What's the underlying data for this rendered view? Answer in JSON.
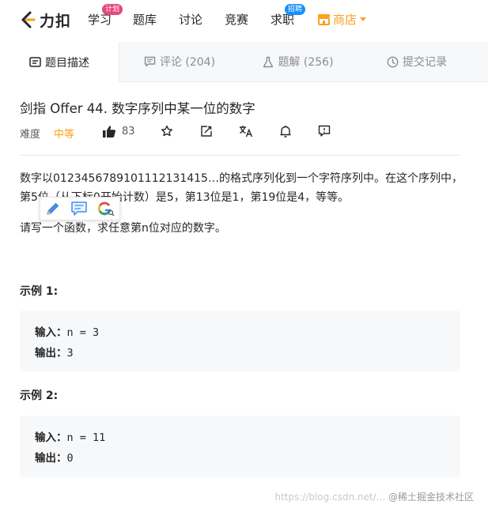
{
  "nav": {
    "logo_text": "力扣",
    "items": [
      {
        "label": "学习",
        "badge": "计划"
      },
      {
        "label": "题库"
      },
      {
        "label": "讨论"
      },
      {
        "label": "竞赛"
      },
      {
        "label": "求职",
        "badge": "招聘"
      }
    ],
    "shop_label": "商店",
    "colors": {
      "accent": "#ffa116",
      "shop": "#ff9f1c",
      "badge_pink": "#e5487a",
      "badge_blue": "#1890ff"
    }
  },
  "tabs": [
    {
      "label": "题目描述",
      "icon": "description-icon",
      "active": true
    },
    {
      "label": "评论 (204)",
      "icon": "comment-icon"
    },
    {
      "label": "题解 (256)",
      "icon": "flask-icon"
    },
    {
      "label": "提交记录",
      "icon": "clock-icon"
    }
  ],
  "problem": {
    "title": "剑指 Offer 44. 数字序列中某一位的数字",
    "difficulty_label": "难度",
    "difficulty": "中等",
    "likes": "83",
    "description_1": "数字以0123456789101112131415…的格式序列化到一个字符序列中。在这个序列中，第5位（从下标0开始计数）是5，第13位是1，第19位是4，等等。",
    "description_2": "请写一个函数，求任意第n位对应的数字。",
    "examples": [
      {
        "heading": "示例 1:",
        "input_label": "输入：",
        "input": "n = 3",
        "output_label": "输出：",
        "output": "3"
      },
      {
        "heading": "示例 2:",
        "input_label": "输入：",
        "input": "n = 11",
        "output_label": "输出：",
        "output": "0"
      }
    ]
  },
  "watermark": {
    "url": "https://blog.csdn.net/...",
    "site": "@稀土掘金技术社区"
  }
}
